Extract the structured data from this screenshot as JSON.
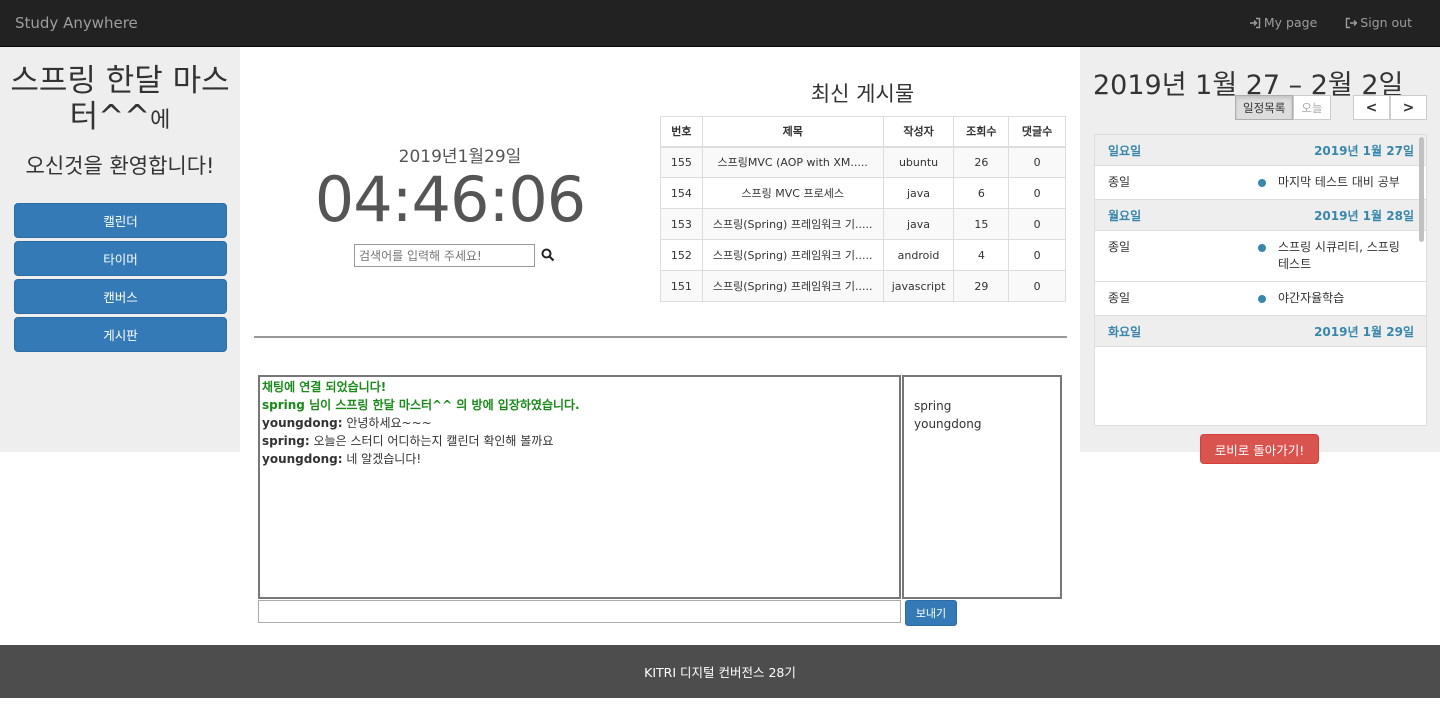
{
  "navbar": {
    "brand": "Study Anywhere",
    "my_page": "My page",
    "sign_out": "Sign out"
  },
  "sidebar": {
    "room_title": "스프링 한달 마스터^^",
    "room_suffix": "에",
    "welcome": "오신것을 환영합니다!",
    "buttons": [
      "캘린더",
      "타이머",
      "캔버스",
      "게시판"
    ]
  },
  "clock": {
    "date": "2019년1월29일",
    "time": "04:46:06"
  },
  "search": {
    "placeholder": "검색어를 입력해 주세요!"
  },
  "board": {
    "title": "최신 게시물",
    "headers": [
      "번호",
      "제목",
      "작성자",
      "조회수",
      "댓글수"
    ],
    "rows": [
      [
        "155",
        "스프링MVC (AOP with XM.....",
        "ubuntu",
        "26",
        "0"
      ],
      [
        "154",
        "스프링 MVC 프로세스",
        "java",
        "6",
        "0"
      ],
      [
        "153",
        "스프링(Spring) 프레임워크 기.....",
        "java",
        "15",
        "0"
      ],
      [
        "152",
        "스프링(Spring) 프레임워크 기.....",
        "android",
        "4",
        "0"
      ],
      [
        "151",
        "스프링(Spring) 프레임워크 기.....",
        "javascript",
        "29",
        "0"
      ]
    ]
  },
  "chat": {
    "system_connected": "채팅에 연결 되었습니다!",
    "system_enter_user": "spring",
    "system_enter_text": " 님이 스프링 한달 마스터^^ 의 방에 입장하였습니다.",
    "messages": [
      {
        "who": "youngdong:",
        "text": " 안녕하세요~~~"
      },
      {
        "who": "spring:",
        "text": " 오늘은 스터디 어디하는지 캘린더 확인해 볼까요"
      },
      {
        "who": "youngdong:",
        "text": " 네 알겠습니다!"
      }
    ],
    "users": [
      "spring",
      "youngdong"
    ],
    "send_label": "보내기"
  },
  "calendar": {
    "title": "2019년 1월 27 – 2월 2일",
    "list_button": "일정목록",
    "today_button": "오늘",
    "prev": "<",
    "next": ">",
    "days": [
      {
        "weekday": "일요일",
        "date": "2019년 1월 27일",
        "events": [
          {
            "time": "종일",
            "title": "마지막 테스트 대비 공부"
          }
        ]
      },
      {
        "weekday": "월요일",
        "date": "2019년 1월 28일",
        "events": [
          {
            "time": "종일",
            "title": "스프링 시큐리티, 스프링 테스트"
          },
          {
            "time": "종일",
            "title": "야간자율학습"
          }
        ]
      },
      {
        "weekday": "화요일",
        "date": "2019년 1월 29일",
        "events": []
      }
    ],
    "event_color": "#3a87ad",
    "lobby_button": "로비로 돌아가기!"
  },
  "footer": {
    "text": "KITRI 디지털 컨버전스 28기"
  }
}
